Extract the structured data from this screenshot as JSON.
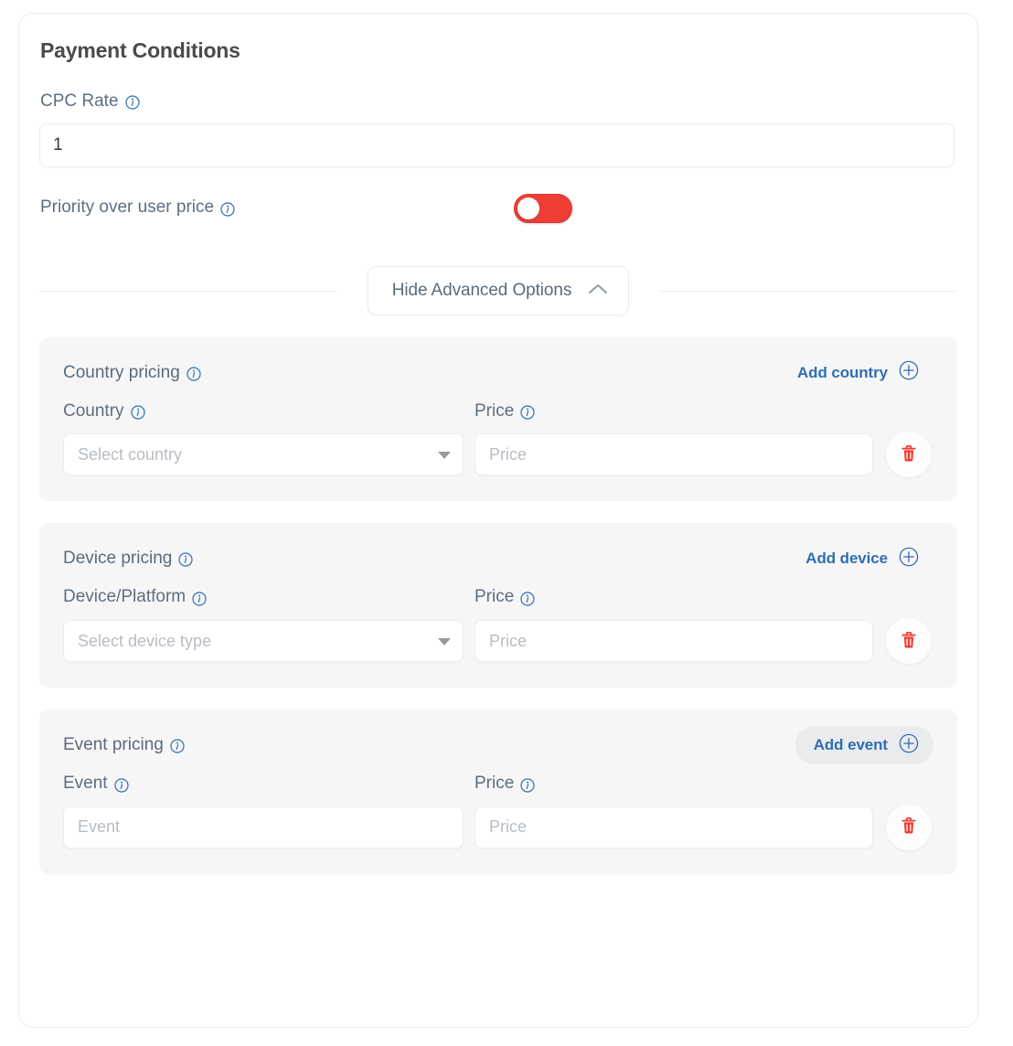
{
  "card": {
    "title": "Payment Conditions"
  },
  "cpc": {
    "label": "CPC Rate",
    "info_icon": "info-icon",
    "value": "1",
    "placeholder": ""
  },
  "priority": {
    "label": "Priority over user price",
    "info_icon": "info-icon",
    "toggle_state": "on",
    "toggle_color": "#ef3e36",
    "knob_color": "#ffffff"
  },
  "advanced": {
    "button_label": "Hide Advanced Options",
    "chevron_icon": "chevron-up-icon",
    "expanded": true
  },
  "sections": [
    {
      "key": "country",
      "title": "Country pricing",
      "title_info_icon": "info-icon",
      "add_label": "Add country",
      "add_icon": "plus-circle-icon",
      "add_hovered": false,
      "col1_label": "Country",
      "col1_info_icon": "info-icon",
      "col2_label": "Price",
      "col2_info_icon": "info-icon",
      "col1_placeholder": "Select country",
      "col1_value": "",
      "col1_type": "select",
      "col2_placeholder": "Price",
      "col2_value": "",
      "delete_icon": "trash-icon"
    },
    {
      "key": "device",
      "title": "Device pricing",
      "title_info_icon": "info-icon",
      "add_label": "Add device",
      "add_icon": "plus-circle-icon",
      "add_hovered": false,
      "col1_label": "Device/Platform",
      "col1_info_icon": "info-icon",
      "col2_label": "Price",
      "col2_info_icon": "info-icon",
      "col1_placeholder": "Select device type",
      "col1_value": "",
      "col1_type": "select",
      "col2_placeholder": "Price",
      "col2_value": "",
      "delete_icon": "trash-icon"
    },
    {
      "key": "event",
      "title": "Event pricing",
      "title_info_icon": "info-icon",
      "add_label": "Add event",
      "add_icon": "plus-circle-icon",
      "add_hovered": true,
      "col1_label": "Event",
      "col1_info_icon": "info-icon",
      "col2_label": "Price",
      "col2_info_icon": "info-icon",
      "col1_placeholder": "Event",
      "col1_value": "",
      "col1_type": "text",
      "col2_placeholder": "Price",
      "col2_value": "",
      "delete_icon": "trash-icon"
    }
  ],
  "colors": {
    "accent_blue": "#2f6fb0",
    "label_slate": "#5a6b7d",
    "danger_red": "#ef3e36",
    "section_bg": "#f6f6f7",
    "card_bg": "#ffffff"
  }
}
